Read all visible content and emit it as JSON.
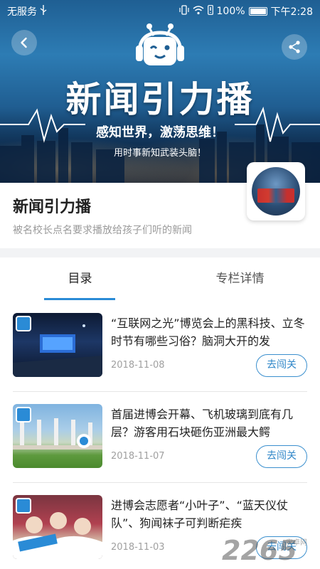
{
  "status_bar": {
    "carrier": "无服务",
    "battery_percent": "100%",
    "time": "下午2:28"
  },
  "hero": {
    "title": "新闻引力播",
    "slogan": "感知世界，激荡思维！",
    "subtitle": "用时事新知武装头脑！"
  },
  "info": {
    "title": "新闻引力播",
    "description": "被名校长点名要求播放给孩子们听的新闻"
  },
  "tabs": [
    {
      "label": "目录",
      "active": true
    },
    {
      "label": "专栏详情",
      "active": false
    }
  ],
  "items": [
    {
      "title": "“互联网之光”博览会上的黑科技、立冬时节有哪些习俗？脑洞大开的发",
      "date": "2018-11-08",
      "button": "去闯关"
    },
    {
      "title": "首届进博会开幕、飞机玻璃到底有几层？游客用石块砸伤亚洲最大鳄",
      "date": "2018-11-07",
      "button": "去闯关"
    },
    {
      "title": "进博会志愿者“小叶子”、“蓝天仪仗队”、狗闻袜子可判断疟疾",
      "date": "2018-11-03",
      "button": "去闯关"
    }
  ],
  "watermark": {
    "main": "2265",
    "sub": "安卓网"
  },
  "colors": {
    "accent": "#2a8bd6",
    "button_border": "#3a8fce",
    "hero_blue": "#2d7cb4"
  },
  "icons": [
    "back-icon",
    "share-icon",
    "usb-icon",
    "vibrate-icon",
    "wifi-icon",
    "alert-icon",
    "battery-icon",
    "robot-logo-icon"
  ]
}
